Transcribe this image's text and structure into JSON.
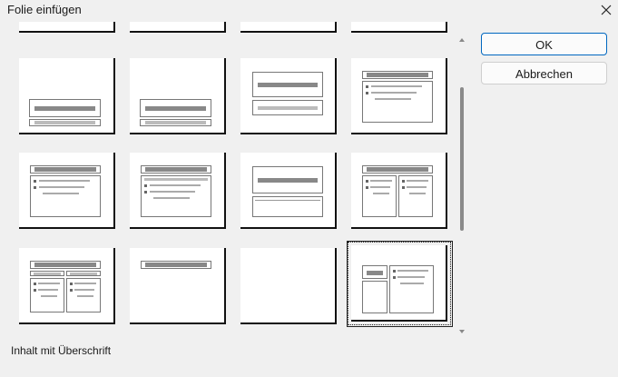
{
  "window": {
    "title": "Folie einfügen",
    "close_icon": "close-icon"
  },
  "buttons": {
    "ok": "OK",
    "cancel": "Abbrechen"
  },
  "caption": "Inhalt mit Überschrift",
  "gallery": {
    "layouts": [
      {
        "row": 1,
        "col": 1,
        "kind": "title-slide"
      },
      {
        "row": 1,
        "col": 2,
        "kind": "section-header"
      },
      {
        "row": 1,
        "col": 3,
        "kind": "title-and-subtitle"
      },
      {
        "row": 1,
        "col": 4,
        "kind": "title-and-content"
      },
      {
        "row": 2,
        "col": 1,
        "kind": "title-content-box"
      },
      {
        "row": 2,
        "col": 2,
        "kind": "title-header-content"
      },
      {
        "row": 2,
        "col": 3,
        "kind": "title-two-boxes"
      },
      {
        "row": 2,
        "col": 4,
        "kind": "two-content"
      },
      {
        "row": 3,
        "col": 1,
        "kind": "comparison"
      },
      {
        "row": 3,
        "col": 2,
        "kind": "title-only"
      },
      {
        "row": 3,
        "col": 3,
        "kind": "blank"
      },
      {
        "row": 3,
        "col": 4,
        "kind": "content-with-caption",
        "selected": true
      }
    ]
  }
}
